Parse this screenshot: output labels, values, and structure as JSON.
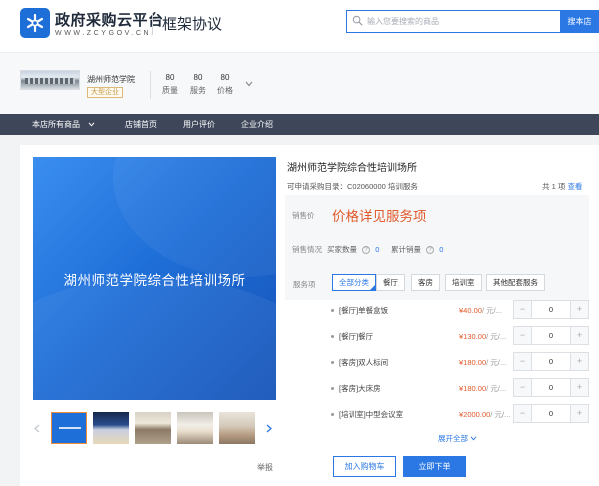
{
  "header": {
    "brand_title": "政府采购云平台",
    "brand_url": "WWW.ZCYGOV.CN",
    "section_title": "框架协议",
    "search": {
      "placeholder": "输入您要搜索的商品",
      "button_label": "搜本店"
    }
  },
  "shop": {
    "name": "湖州师范学院",
    "badge": "大型企业",
    "scores": [
      {
        "value": "80",
        "label": "质量"
      },
      {
        "value": "80",
        "label": "服务"
      },
      {
        "value": "80",
        "label": "价格"
      }
    ]
  },
  "nav": {
    "items": [
      {
        "label": "本店所有商品"
      },
      {
        "label": "店铺首页"
      },
      {
        "label": "用户评价"
      },
      {
        "label": "企业介绍"
      }
    ]
  },
  "gallery": {
    "main_image_title": "湖州师范学院综合性培训场所",
    "report_label": "举报"
  },
  "product": {
    "title": "湖州师范学院综合性培训场所",
    "catalog": "可申请采购目录：C02060000 培训服务",
    "count_text": "共 1 项",
    "count_view": "查看",
    "price_label": "销售价",
    "price_text": "价格详见服务项",
    "sales_label": "销售情况",
    "buyer_label": "买家数量",
    "buyer_count": "0",
    "total_label": "累计销量",
    "total_count": "0",
    "service_label": "服务项",
    "filters": [
      {
        "label": "全部分类"
      },
      {
        "label": "餐厅"
      },
      {
        "label": "客房"
      },
      {
        "label": "培训室"
      },
      {
        "label": "其他配套服务"
      }
    ],
    "items": [
      {
        "name": "[餐厅]单餐盒饭",
        "price": "¥40.00",
        "unit": "/ 元/...",
        "qty": "0"
      },
      {
        "name": "[餐厅]餐厅",
        "price": "¥130.00",
        "unit": "/ 元/...",
        "qty": "0"
      },
      {
        "name": "[客房]双人标间",
        "price": "¥180.00",
        "unit": "/ 元/...",
        "qty": "0"
      },
      {
        "name": "[客房]大床房",
        "price": "¥180.00",
        "unit": "/ 元/...",
        "qty": "0"
      },
      {
        "name": "[培训室]中型会议室",
        "price": "¥2000.00",
        "unit": "/ 元/...",
        "qty": "0"
      }
    ],
    "expand_label": "展开全部",
    "add_to_cart": "加入购物车",
    "buy_now": "立即下单"
  },
  "colors": {
    "brand": "#2b78e4",
    "nav_bg": "#3e475a",
    "price": "#e05a2b"
  }
}
